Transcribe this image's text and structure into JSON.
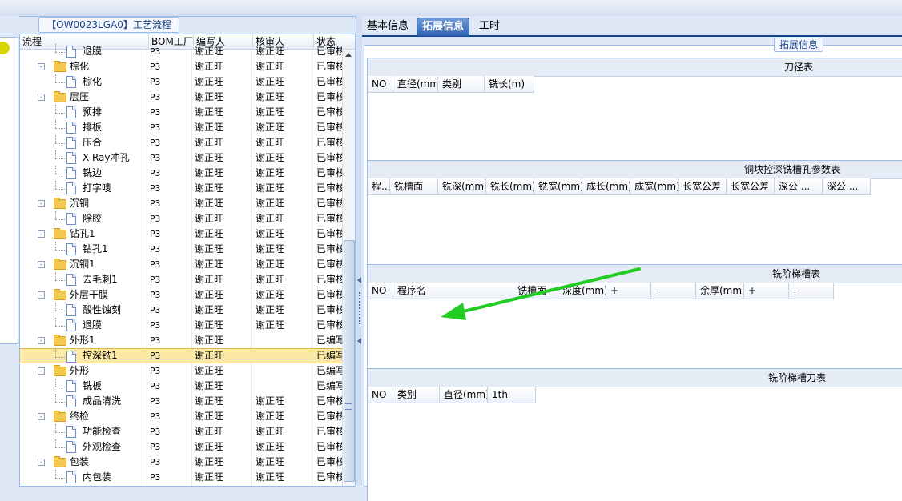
{
  "left_panel": {
    "title": "【OW0023LGA0】工艺流程",
    "columns": [
      "流程",
      "BOM工厂",
      "编写人",
      "核审人",
      "状态"
    ],
    "rows": [
      {
        "level": 1,
        "type": "doc",
        "label": "退膜",
        "bom": "P3",
        "writer": "谢正旺",
        "reviewer": "谢正旺",
        "status": "已审核"
      },
      {
        "level": 0,
        "type": "folder",
        "label": "棕化",
        "bom": "P3",
        "writer": "谢正旺",
        "reviewer": "谢正旺",
        "status": "已审核"
      },
      {
        "level": 1,
        "type": "doc",
        "label": "棕化",
        "bom": "P3",
        "writer": "谢正旺",
        "reviewer": "谢正旺",
        "status": "已审核"
      },
      {
        "level": 0,
        "type": "folder",
        "label": "层压",
        "bom": "P3",
        "writer": "谢正旺",
        "reviewer": "谢正旺",
        "status": "已审核"
      },
      {
        "level": 1,
        "type": "doc",
        "label": "预排",
        "bom": "P3",
        "writer": "谢正旺",
        "reviewer": "谢正旺",
        "status": "已审核"
      },
      {
        "level": 1,
        "type": "doc",
        "label": "排板",
        "bom": "P3",
        "writer": "谢正旺",
        "reviewer": "谢正旺",
        "status": "已审核"
      },
      {
        "level": 1,
        "type": "doc",
        "label": "压合",
        "bom": "P3",
        "writer": "谢正旺",
        "reviewer": "谢正旺",
        "status": "已审核"
      },
      {
        "level": 1,
        "type": "doc",
        "label": "X-Ray冲孔",
        "bom": "P3",
        "writer": "谢正旺",
        "reviewer": "谢正旺",
        "status": "已审核"
      },
      {
        "level": 1,
        "type": "doc",
        "label": "铣边",
        "bom": "P3",
        "writer": "谢正旺",
        "reviewer": "谢正旺",
        "status": "已审核"
      },
      {
        "level": 1,
        "type": "doc",
        "label": "打字唛",
        "bom": "P3",
        "writer": "谢正旺",
        "reviewer": "谢正旺",
        "status": "已审核"
      },
      {
        "level": 0,
        "type": "folder",
        "label": "沉铜",
        "bom": "P3",
        "writer": "谢正旺",
        "reviewer": "谢正旺",
        "status": "已审核"
      },
      {
        "level": 1,
        "type": "doc",
        "label": "除胶",
        "bom": "P3",
        "writer": "谢正旺",
        "reviewer": "谢正旺",
        "status": "已审核"
      },
      {
        "level": 0,
        "type": "folder",
        "label": "钻孔1",
        "bom": "P3",
        "writer": "谢正旺",
        "reviewer": "谢正旺",
        "status": "已审核"
      },
      {
        "level": 1,
        "type": "doc",
        "label": "钻孔1",
        "bom": "P3",
        "writer": "谢正旺",
        "reviewer": "谢正旺",
        "status": "已审核"
      },
      {
        "level": 0,
        "type": "folder",
        "label": "沉铜1",
        "bom": "P3",
        "writer": "谢正旺",
        "reviewer": "谢正旺",
        "status": "已审核"
      },
      {
        "level": 1,
        "type": "doc",
        "label": "去毛刺1",
        "bom": "P3",
        "writer": "谢正旺",
        "reviewer": "谢正旺",
        "status": "已审核"
      },
      {
        "level": 0,
        "type": "folder",
        "label": "外层干膜",
        "bom": "P3",
        "writer": "谢正旺",
        "reviewer": "谢正旺",
        "status": "已审核"
      },
      {
        "level": 1,
        "type": "doc",
        "label": "酸性蚀刻",
        "bom": "P3",
        "writer": "谢正旺",
        "reviewer": "谢正旺",
        "status": "已审核"
      },
      {
        "level": 1,
        "type": "doc",
        "label": "退膜",
        "bom": "P3",
        "writer": "谢正旺",
        "reviewer": "谢正旺",
        "status": "已审核"
      },
      {
        "level": 0,
        "type": "folder",
        "label": "外形1",
        "bom": "P3",
        "writer": "谢正旺",
        "reviewer": "",
        "status": "已编写"
      },
      {
        "level": 1,
        "type": "doc",
        "label": "控深铣1",
        "bom": "P3",
        "writer": "谢正旺",
        "reviewer": "",
        "status": "已编写",
        "selected": true
      },
      {
        "level": 0,
        "type": "folder",
        "label": "外形",
        "bom": "P3",
        "writer": "谢正旺",
        "reviewer": "",
        "status": "已编写"
      },
      {
        "level": 1,
        "type": "doc",
        "label": "铣板",
        "bom": "P3",
        "writer": "谢正旺",
        "reviewer": "",
        "status": "已编写"
      },
      {
        "level": 1,
        "type": "doc",
        "label": "成品清洗",
        "bom": "P3",
        "writer": "谢正旺",
        "reviewer": "谢正旺",
        "status": "已审核"
      },
      {
        "level": 0,
        "type": "folder",
        "label": "终检",
        "bom": "P3",
        "writer": "谢正旺",
        "reviewer": "谢正旺",
        "status": "已审核"
      },
      {
        "level": 1,
        "type": "doc",
        "label": "功能检查",
        "bom": "P3",
        "writer": "谢正旺",
        "reviewer": "谢正旺",
        "status": "已审核"
      },
      {
        "level": 1,
        "type": "doc",
        "label": "外观检查",
        "bom": "P3",
        "writer": "谢正旺",
        "reviewer": "谢正旺",
        "status": "已审核"
      },
      {
        "level": 0,
        "type": "folder",
        "label": "包装",
        "bom": "P3",
        "writer": "谢正旺",
        "reviewer": "谢正旺",
        "status": "已审核"
      },
      {
        "level": 1,
        "type": "doc",
        "label": "内包装",
        "bom": "P3",
        "writer": "谢正旺",
        "reviewer": "谢正旺",
        "status": "已审核"
      }
    ]
  },
  "right_panel": {
    "tabs": [
      {
        "label": "基本信息",
        "active": false
      },
      {
        "label": "拓展信息",
        "active": true
      },
      {
        "label": "工时",
        "active": false
      }
    ],
    "fieldset_legend": "拓展信息",
    "sections": [
      {
        "title": "刀径表",
        "columns": [
          "NO",
          "直径(mm)",
          "类别",
          "铣长(m)"
        ]
      },
      {
        "title": "铜块控深铣槽孔参数表",
        "columns": [
          "程...",
          "铣槽面",
          "铣深(mm)",
          "铣长(mm)",
          "铣宽(mm)",
          "成长(mm)",
          "成宽(mm)",
          "长宽公差",
          "长宽公差",
          "深公 ...",
          "深公 ..."
        ]
      },
      {
        "title": "铣阶梯槽表",
        "columns": [
          "NO",
          "程序名",
          "铣槽面",
          "深度(mm)",
          "+",
          "-",
          "余厚(mm)",
          "+",
          "-"
        ]
      },
      {
        "title": "铣阶梯槽刀表",
        "columns": [
          "NO",
          "类别",
          "直径(mm)",
          "1th"
        ]
      }
    ]
  },
  "colors": {
    "accent": "#15428b",
    "selected_row": "#fde9a6",
    "annotation_arrow": "#22cc22"
  }
}
